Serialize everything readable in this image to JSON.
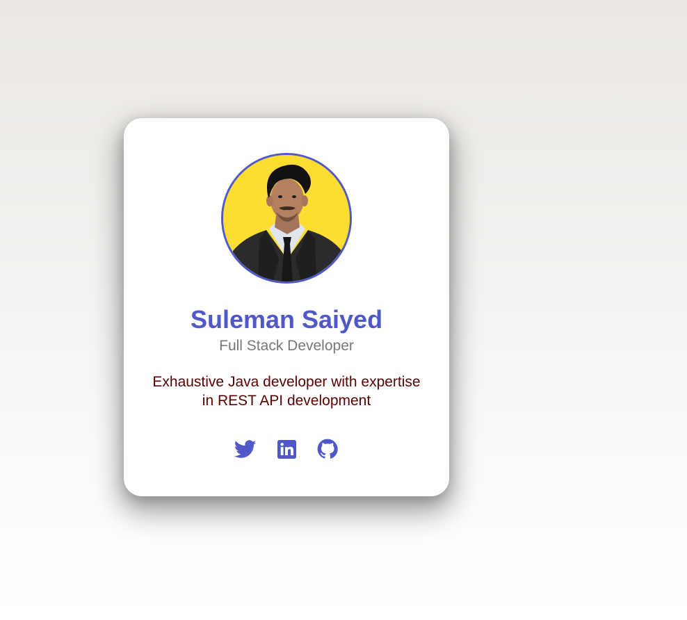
{
  "profile": {
    "name": "Suleman Saiyed",
    "role": "Full Stack Developer",
    "bio": "Exhaustive Java developer with expertise in REST API development",
    "avatar_background": "#fedd33"
  },
  "social_links": [
    {
      "icon": "twitter-icon"
    },
    {
      "icon": "linkedin-icon"
    },
    {
      "icon": "github-icon"
    }
  ],
  "colors": {
    "accent": "#4f58c6",
    "role_text": "#777777",
    "bio_text": "#5a0000",
    "card_bg": "#ffffff"
  }
}
